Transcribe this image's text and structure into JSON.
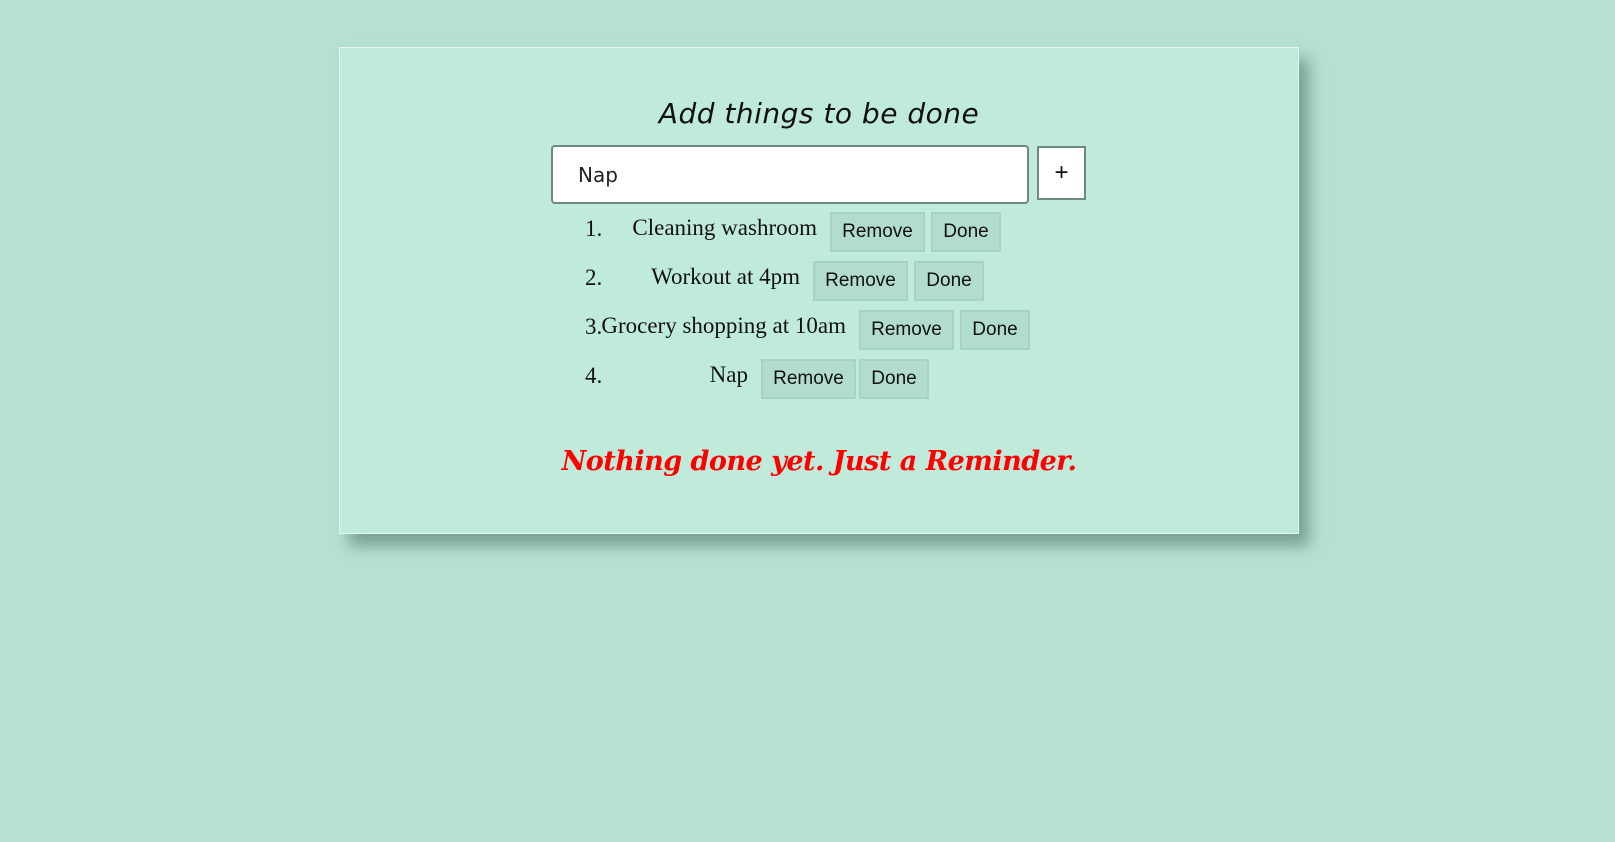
{
  "header": {
    "title": "Add things to be done"
  },
  "input": {
    "value": "Nap",
    "add_label": "+"
  },
  "tasks": [
    {
      "number": "1.",
      "text": "Cleaning washroom",
      "remove_label": "Remove",
      "done_label": "Done"
    },
    {
      "number": "2.",
      "text": "Workout at 4pm",
      "remove_label": "Remove",
      "done_label": "Done"
    },
    {
      "number": "3.",
      "text": "Grocery shopping at 10am",
      "remove_label": "Remove",
      "done_label": "Done"
    },
    {
      "number": "4.",
      "text": "Nap",
      "remove_label": "Remove",
      "done_label": "Done"
    }
  ],
  "status": {
    "message": "Nothing done yet. Just a Reminder."
  },
  "colors": {
    "page_background": "#b6e1d1",
    "card_background": "#c0ebdb",
    "button_background": "#b2ddcd",
    "reminder_text": "#ff0000"
  }
}
